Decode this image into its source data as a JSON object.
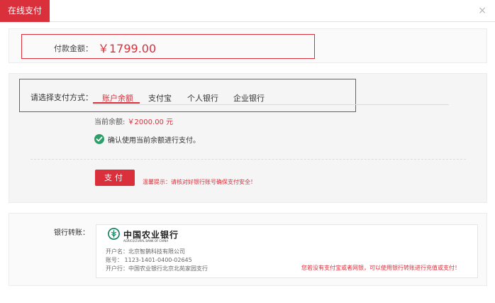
{
  "dialog": {
    "title": "在线支付",
    "close": "×"
  },
  "payment": {
    "amount_label": "付款金额：",
    "amount": "￥1799.00"
  },
  "methods": {
    "label": "请选择支付方式：",
    "tabs": [
      "账户余额",
      "支付宝",
      "个人银行",
      "企业银行"
    ],
    "active_tab": 0,
    "balance_label": "当前余额:",
    "balance_value": "￥2000.00 元",
    "confirm_text": "确认使用当前余额进行支付。",
    "pay_button": "支付",
    "tip": "温馨提示：请核对好银行账号确保支付安全！"
  },
  "bank": {
    "label": "银行转账：",
    "name": "中国农业银行",
    "name_en": "AGRICULTURAL BANK OF CHINA",
    "account_holder": "开户名：北京智鹊科技有限公司",
    "account_number": "账号： 1123-1401-0400-02645",
    "branch": "开户行：中国农业银行北京北苑家园支行",
    "note": "您若没有支付宝或者网银，可以使用银行转账进行充值或支付！"
  },
  "colors": {
    "accent": "#d9303c",
    "success": "#2e9e6b"
  }
}
